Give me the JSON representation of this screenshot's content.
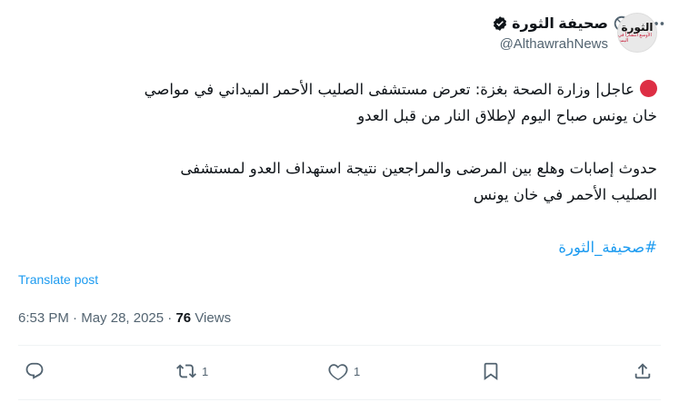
{
  "author": {
    "display_name": "صحيفة الثورة",
    "handle": "@AlthawrahNews",
    "avatar_logo": "الثورة",
    "avatar_tagline": "الأوسع انتشاراً في اليمن"
  },
  "post": {
    "line1": "عاجل| وزارة الصحة بغزة: تعرض مستشفى الصليب الأحمر الميداني في مواصي",
    "line2": "خان يونس صباح اليوم لإطلاق النار من قبل العدو",
    "line3": "حدوث إصابات وهلع بين المرضى والمراجعين نتيجة استهداف العدو لمستشفى",
    "line4": "الصليب الأحمر في خان يونس",
    "hashtag": "#صحيفة_الثورة"
  },
  "translate_label": "Translate post",
  "meta": {
    "time": "6:53 PM",
    "date": "May 28, 2025",
    "views_count": "76",
    "views_label": "Views",
    "separator": "·"
  },
  "actions": {
    "reply_count": "",
    "repost_count": "1",
    "like_count": "1"
  },
  "icons": [
    "grok-icon",
    "more-icon",
    "verified-icon",
    "red-circle-icon",
    "reply-icon",
    "repost-icon",
    "like-icon",
    "bookmark-icon",
    "share-icon"
  ],
  "colors": {
    "link": "#1d9bf0",
    "muted": "#536471",
    "text": "#0f1419",
    "red_dot": "#dd2e44"
  }
}
